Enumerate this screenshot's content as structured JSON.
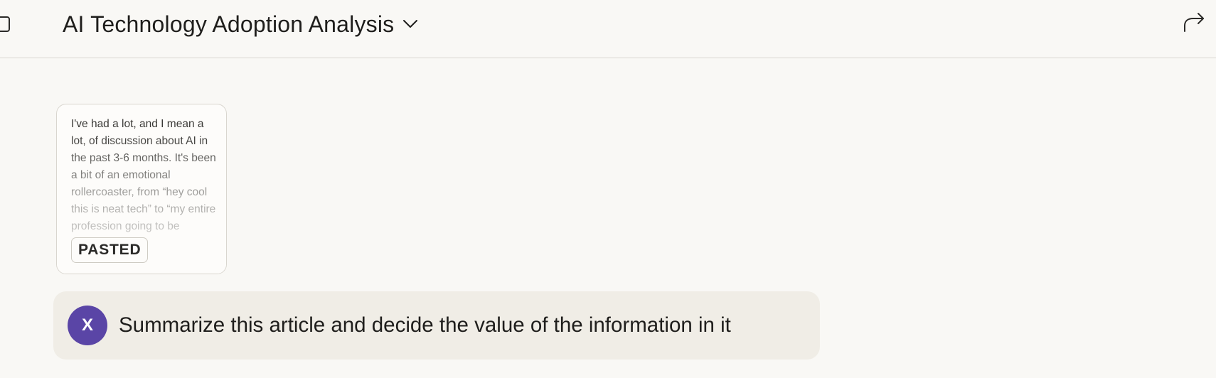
{
  "header": {
    "title": "AI Technology Adoption Analysis",
    "icons": {
      "sidebar_toggle": "sidebar-toggle-icon",
      "title_dropdown": "chevron-down-icon",
      "share": "share-arrow-icon"
    }
  },
  "attachment": {
    "text": "I've had a lot, and I mean a lot, of discussion about AI in the past 3-6 months. It's been a bit of an emotional rollercoaster, from “hey cool this is neat tech” to “my entire profession going to be",
    "badge": "PASTED"
  },
  "message": {
    "avatar_initial": "X",
    "text": "Summarize this article and decide the value of the information in it"
  },
  "colors": {
    "background": "#f9f8f5",
    "message_bubble": "#f0ede6",
    "avatar": "#5a45a6",
    "header_border": "#d8d6d0"
  }
}
